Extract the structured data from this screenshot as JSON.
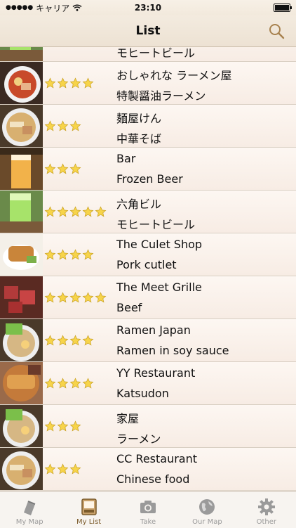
{
  "status_bar": {
    "carrier": "キャリア",
    "time": "23:10"
  },
  "nav": {
    "title": "List",
    "search_icon": "search-icon"
  },
  "list": {
    "items": [
      {
        "title": "",
        "subtitle": "モヒートビール",
        "stars": 0,
        "thumb": "mojito"
      },
      {
        "title": "おしゃれな ラーメン屋",
        "subtitle": "特製醤油ラーメン",
        "stars": 4,
        "thumb": "ramen-red"
      },
      {
        "title": "麺屋けん",
        "subtitle": "中華そば",
        "stars": 3,
        "thumb": "ramen"
      },
      {
        "title": "Bar",
        "subtitle": "Frozen Beer",
        "stars": 3,
        "thumb": "beer"
      },
      {
        "title": "六角ビル",
        "subtitle": "モヒートビール",
        "stars": 5,
        "thumb": "mojito"
      },
      {
        "title": "The Culet Shop",
        "subtitle": "Pork cutlet",
        "stars": 4,
        "thumb": "cutlet"
      },
      {
        "title": "The Meet Grille",
        "subtitle": "Beef",
        "stars": 5,
        "thumb": "beef"
      },
      {
        "title": "Ramen Japan",
        "subtitle": "Ramen in soy sauce",
        "stars": 4,
        "thumb": "ramen-green"
      },
      {
        "title": "YY Restaurant",
        "subtitle": "Katsudon",
        "stars": 4,
        "thumb": "katsudon"
      },
      {
        "title": "家屋",
        "subtitle": "ラーメン",
        "stars": 3,
        "thumb": "ramen-green"
      },
      {
        "title": "CC Restaurant",
        "subtitle": "Chinese food",
        "stars": 3,
        "thumb": "ramen"
      }
    ]
  },
  "tab_bar": {
    "tabs": [
      {
        "label": "My Map",
        "icon": "pin-icon",
        "active": false
      },
      {
        "label": "My List",
        "icon": "list-icon",
        "active": true
      },
      {
        "label": "Take",
        "icon": "camera-icon",
        "active": false
      },
      {
        "label": "Our Map",
        "icon": "globe-icon",
        "active": false
      },
      {
        "label": "Other",
        "icon": "gear-icon",
        "active": false
      }
    ]
  },
  "colors": {
    "star": "#f7d44a",
    "active_tab": "#7a5a2a",
    "inactive_tab": "#9a9a9a"
  }
}
